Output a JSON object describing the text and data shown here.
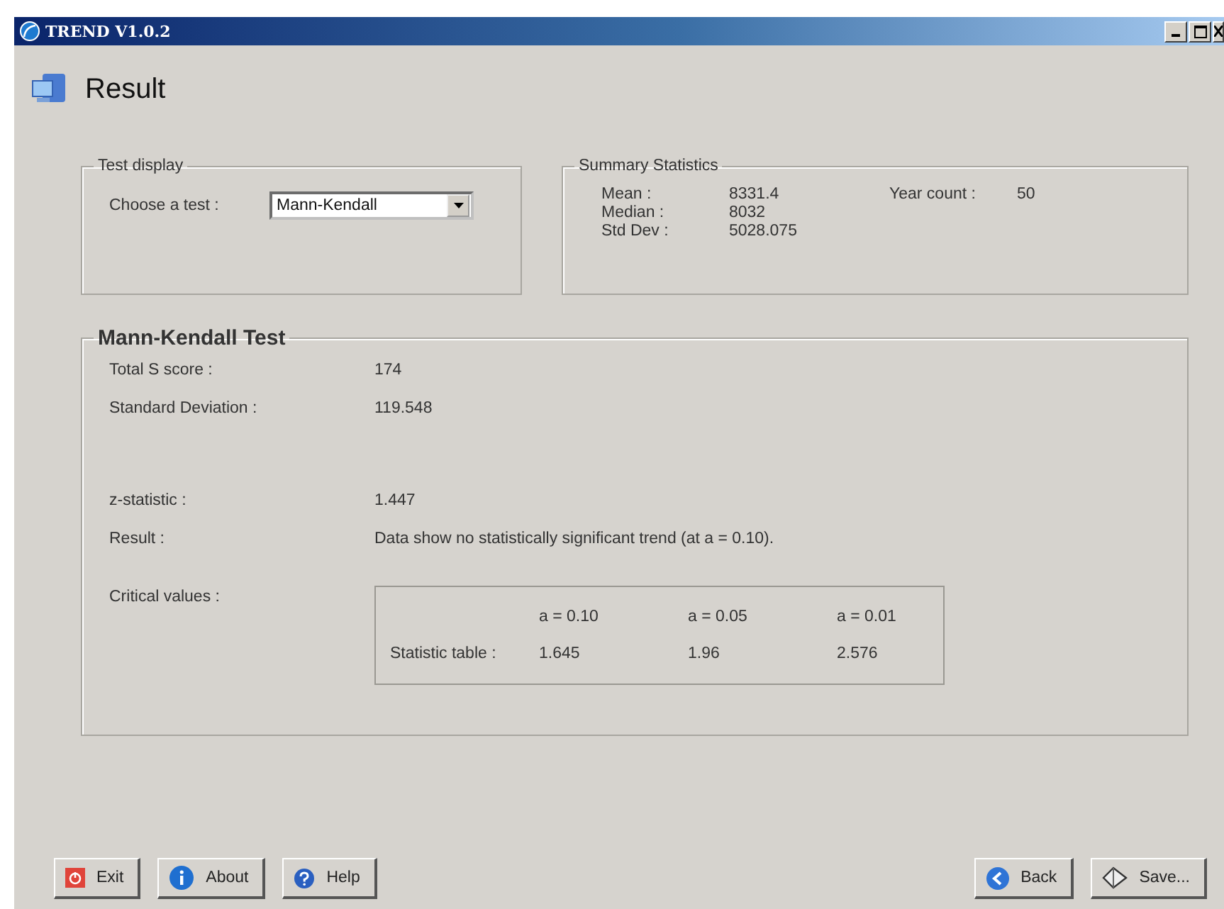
{
  "window": {
    "title": "TREND V1.0.2"
  },
  "page_title": "Result",
  "test_display": {
    "legend": "Test display",
    "label": "Choose a test :",
    "value": "Mann-Kendall"
  },
  "summary": {
    "legend": "Summary Statistics",
    "rows": [
      {
        "label": "Mean :",
        "value": "8331.4"
      },
      {
        "label": "Median :",
        "value": "8032"
      },
      {
        "label": "Std Dev :",
        "value": "5028.075"
      }
    ],
    "extra": {
      "label": "Year count :",
      "value": "50"
    }
  },
  "test": {
    "legend": "Mann-Kendall Test",
    "rows": [
      {
        "label": "Total S score  :",
        "value": "174"
      },
      {
        "label": "Standard Deviation :",
        "value": "119.548"
      },
      {
        "label": "z-statistic :",
        "value": "1.447"
      },
      {
        "label": "Result :",
        "value": "Data show no statistically significant trend (at a = 0.10)."
      }
    ],
    "critical_label": "Critical values :",
    "table": {
      "columns": [
        "a = 0.10",
        "a = 0.05",
        "a = 0.01"
      ],
      "row_label": "Statistic table :",
      "values": [
        "1.645",
        "1.96",
        "2.576"
      ]
    }
  },
  "left_buttons": [
    {
      "kind": "exit",
      "label": "Exit"
    },
    {
      "kind": "about",
      "label": "About"
    },
    {
      "kind": "help",
      "label": "Help"
    }
  ],
  "right_buttons": [
    {
      "kind": "back",
      "label": "Back"
    },
    {
      "kind": "save",
      "label": "Save..."
    }
  ]
}
